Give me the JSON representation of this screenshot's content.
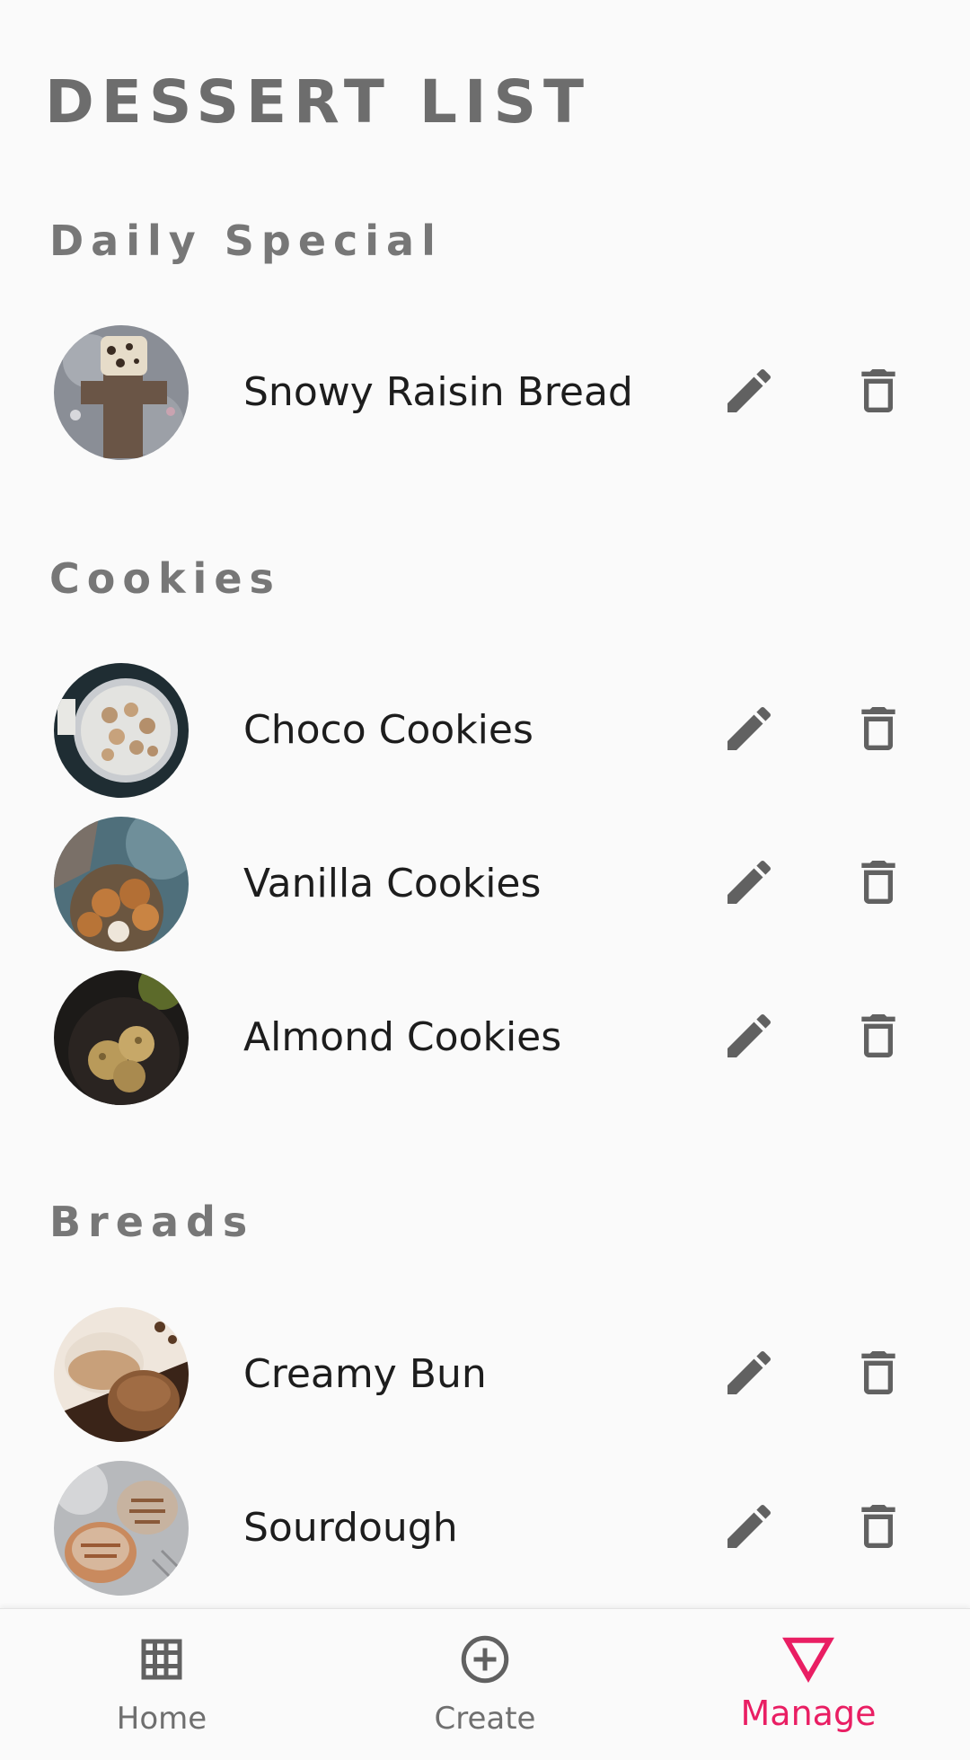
{
  "header": {
    "title": "DESSERT LIST"
  },
  "sections": [
    {
      "title": "Daily Special",
      "items": [
        {
          "name": "Snowy Raisin Bread",
          "thumbnail": "raisin-bread-photo"
        }
      ]
    },
    {
      "title": "Cookies",
      "items": [
        {
          "name": "Choco Cookies",
          "thumbnail": "choco-cookies-photo"
        },
        {
          "name": "Vanilla Cookies",
          "thumbnail": "vanilla-cookies-photo"
        },
        {
          "name": "Almond Cookies",
          "thumbnail": "almond-cookies-photo"
        }
      ]
    },
    {
      "title": "Breads",
      "items": [
        {
          "name": "Creamy Bun",
          "thumbnail": "creamy-bun-photo"
        },
        {
          "name": "Sourdough",
          "thumbnail": "sourdough-photo"
        }
      ]
    }
  ],
  "icons": {
    "edit": "pencil-icon",
    "delete": "trash-icon"
  },
  "bottom_nav": {
    "items": [
      {
        "label": "Home",
        "icon": "grid-icon",
        "active": false
      },
      {
        "label": "Create",
        "icon": "add-circle-icon",
        "active": false
      },
      {
        "label": "Manage",
        "icon": "triangle-down-icon",
        "active": true
      }
    ]
  },
  "colors": {
    "background": "#fafafa",
    "title": "#6d6d6d",
    "section_title": "#777777",
    "item_text": "#1d1d1d",
    "icon": "#616161",
    "accent": "#e91e63"
  }
}
